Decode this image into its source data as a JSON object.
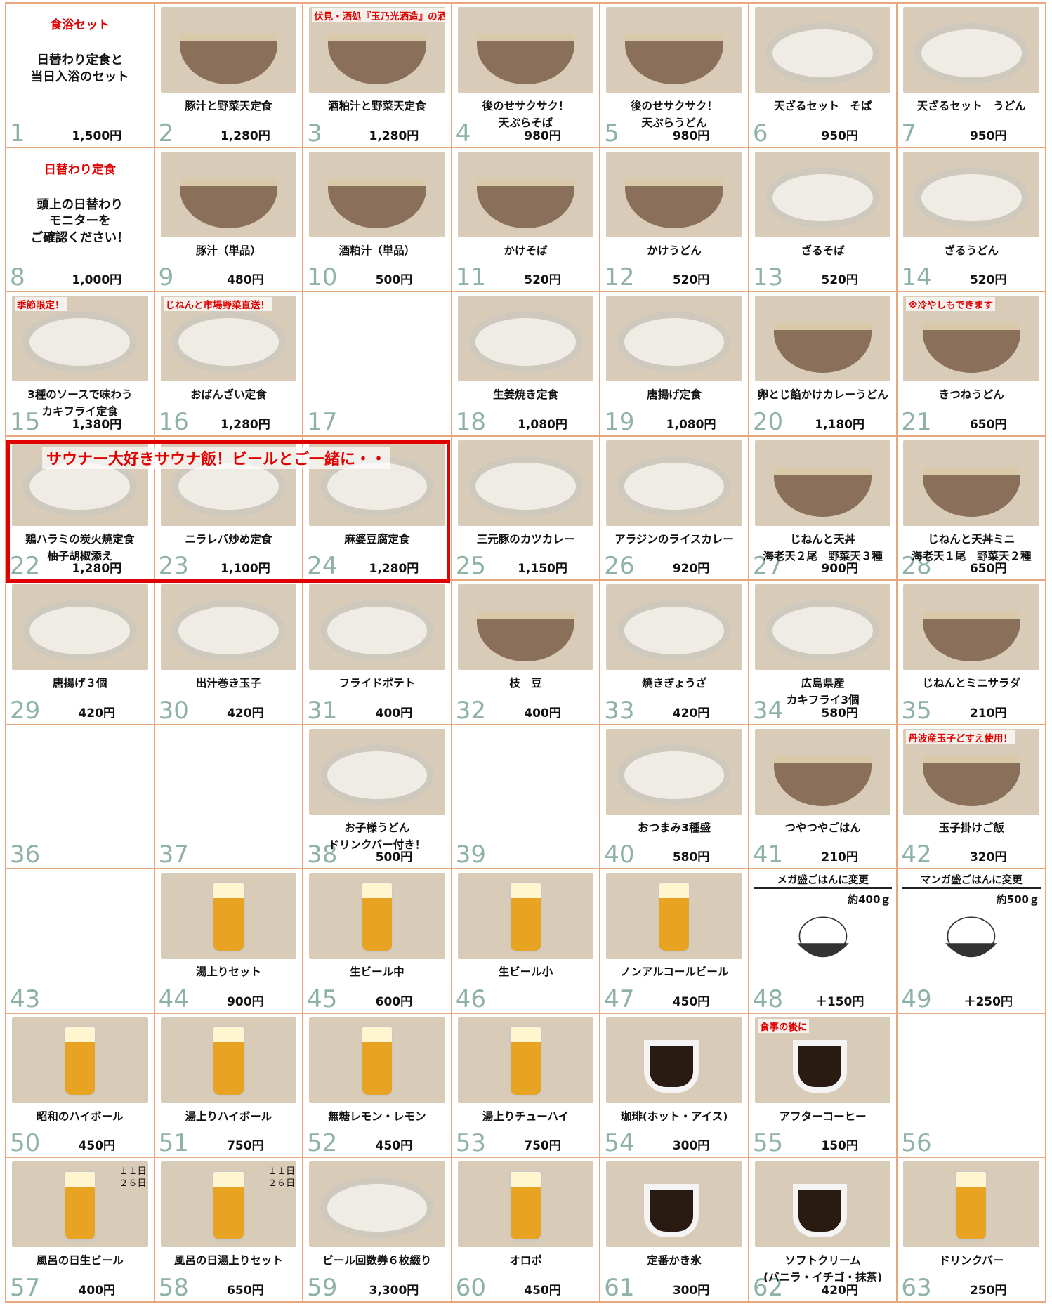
{
  "cells": [
    {
      "n": "1",
      "price": "1,500円",
      "kind": "text",
      "title": "食浴セット",
      "lines": [
        "日替わり定食と",
        "当日入浴のセット"
      ]
    },
    {
      "n": "2",
      "price": "1,280円",
      "name": "豚汁と野菜天定食",
      "kind": "photo",
      "ph": "bowl"
    },
    {
      "n": "3",
      "price": "1,280円",
      "name": "酒粕汁と野菜天定食",
      "kind": "photo",
      "ph": "bowl",
      "tag": "伏見・酒処『玉乃光酒造』の酒粕使用"
    },
    {
      "n": "4",
      "price": "980円",
      "name": "後のせサクサク！\n天ぷらそば",
      "kind": "photo",
      "ph": "bowl"
    },
    {
      "n": "5",
      "price": "980円",
      "name": "後のせサクサク！\n天ぷらうどん",
      "kind": "photo",
      "ph": "bowl"
    },
    {
      "n": "6",
      "price": "950円",
      "name": "天ざるセット　そば",
      "kind": "photo",
      "ph": "plate"
    },
    {
      "n": "7",
      "price": "950円",
      "name": "天ざるセット　うどん",
      "kind": "photo",
      "ph": "plate"
    },
    {
      "n": "8",
      "price": "1,000円",
      "kind": "text",
      "title": "日替わり定食",
      "lines": [
        "頭上の日替わり",
        "モニターを",
        "ご確認ください！"
      ]
    },
    {
      "n": "9",
      "price": "480円",
      "name": "豚汁（単品）",
      "kind": "photo",
      "ph": "bowl"
    },
    {
      "n": "10",
      "price": "500円",
      "name": "酒粕汁（単品）",
      "kind": "photo",
      "ph": "bowl"
    },
    {
      "n": "11",
      "price": "520円",
      "name": "かけそば",
      "kind": "photo",
      "ph": "bowl"
    },
    {
      "n": "12",
      "price": "520円",
      "name": "かけうどん",
      "kind": "photo",
      "ph": "bowl"
    },
    {
      "n": "13",
      "price": "520円",
      "name": "ざるそば",
      "kind": "photo",
      "ph": "plate"
    },
    {
      "n": "14",
      "price": "520円",
      "name": "ざるうどん",
      "kind": "photo",
      "ph": "plate"
    },
    {
      "n": "15",
      "price": "1,380円",
      "name": "3種のソースで味わう\nカキフライ定食",
      "kind": "photo",
      "ph": "plate",
      "tag": "季節限定！"
    },
    {
      "n": "16",
      "price": "1,280円",
      "name": "おばんざい定食",
      "kind": "photo",
      "ph": "plate",
      "tag": "じねんと市場野菜直送！"
    },
    {
      "n": "17",
      "kind": "empty"
    },
    {
      "n": "18",
      "price": "1,080円",
      "name": "生姜焼き定食",
      "kind": "photo",
      "ph": "plate"
    },
    {
      "n": "19",
      "price": "1,080円",
      "name": "唐揚げ定食",
      "kind": "photo",
      "ph": "plate"
    },
    {
      "n": "20",
      "price": "1,180円",
      "name": "卵とじ餡かけカレーうどん",
      "kind": "photo",
      "ph": "bowl"
    },
    {
      "n": "21",
      "price": "650円",
      "name": "きつねうどん",
      "kind": "photo",
      "ph": "bowl",
      "tag": "※冷やしもできます"
    },
    {
      "n": "22",
      "price": "1,280円",
      "name": "鶏ハラミの炭火焼定食\n柚子胡椒添え",
      "kind": "photo",
      "ph": "plate"
    },
    {
      "n": "23",
      "price": "1,100円",
      "name": "ニラレバ炒め定食",
      "kind": "photo",
      "ph": "plate"
    },
    {
      "n": "24",
      "price": "1,280円",
      "name": "麻婆豆腐定食",
      "kind": "photo",
      "ph": "plate"
    },
    {
      "n": "25",
      "price": "1,150円",
      "name": "三元豚のカツカレー",
      "kind": "photo",
      "ph": "plate"
    },
    {
      "n": "26",
      "price": "920円",
      "name": "アラジンのライスカレー",
      "kind": "photo",
      "ph": "plate"
    },
    {
      "n": "27",
      "price": "900円",
      "name": "じねんと天丼\n海老天２尾　野菜天３種",
      "kind": "photo",
      "ph": "bowl"
    },
    {
      "n": "28",
      "price": "650円",
      "name": "じねんと天丼ミニ\n海老天１尾　野菜天２種",
      "kind": "photo",
      "ph": "bowl"
    },
    {
      "n": "29",
      "price": "420円",
      "name": "唐揚げ３個",
      "kind": "photo",
      "ph": "plate"
    },
    {
      "n": "30",
      "price": "420円",
      "name": "出汁巻き玉子",
      "kind": "photo",
      "ph": "plate"
    },
    {
      "n": "31",
      "price": "400円",
      "name": "フライドポテト",
      "kind": "photo",
      "ph": "plate"
    },
    {
      "n": "32",
      "price": "400円",
      "name": "枝　豆",
      "kind": "photo",
      "ph": "bowl"
    },
    {
      "n": "33",
      "price": "420円",
      "name": "焼きぎょうざ",
      "kind": "photo",
      "ph": "plate"
    },
    {
      "n": "34",
      "price": "580円",
      "name": "広島県産\nカキフライ3個",
      "kind": "photo",
      "ph": "plate"
    },
    {
      "n": "35",
      "price": "210円",
      "name": "じねんとミニサラダ",
      "kind": "photo",
      "ph": "bowl"
    },
    {
      "n": "36",
      "kind": "empty"
    },
    {
      "n": "37",
      "kind": "empty"
    },
    {
      "n": "38",
      "price": "500円",
      "name": "お子様うどん\nドリンクバー付き！",
      "kind": "photo",
      "ph": "plate"
    },
    {
      "n": "39",
      "kind": "empty"
    },
    {
      "n": "40",
      "price": "580円",
      "name": "おつまみ3種盛",
      "kind": "photo",
      "ph": "plate"
    },
    {
      "n": "41",
      "price": "210円",
      "name": "つやつやごはん",
      "kind": "photo",
      "ph": "bowl"
    },
    {
      "n": "42",
      "price": "320円",
      "name": "玉子掛けご飯",
      "kind": "photo",
      "ph": "bowl",
      "tag": "丹波産玉子どすえ使用！"
    },
    {
      "n": "43",
      "kind": "empty"
    },
    {
      "n": "44",
      "price": "900円",
      "name": "湯上りセット",
      "kind": "photo",
      "ph": "glass"
    },
    {
      "n": "45",
      "price": "600円",
      "name": "生ビール中",
      "kind": "photo",
      "ph": "glass"
    },
    {
      "n": "46",
      "price": "",
      "name": "生ビール小",
      "kind": "photo",
      "ph": "glass"
    },
    {
      "n": "47",
      "price": "450円",
      "name": "ノンアルコールビール",
      "kind": "photo",
      "ph": "glass"
    },
    {
      "n": "48",
      "price": "＋150円",
      "kind": "rice",
      "header": "メガ盛ごはんに変更",
      "weight": "約400ｇ"
    },
    {
      "n": "49",
      "price": "＋250円",
      "kind": "rice",
      "header": "マンガ盛ごはんに変更",
      "weight": "約500ｇ"
    },
    {
      "n": "50",
      "price": "450円",
      "name": "昭和のハイボール",
      "kind": "photo",
      "ph": "glass"
    },
    {
      "n": "51",
      "price": "750円",
      "name": "湯上りハイボール",
      "kind": "photo",
      "ph": "glass"
    },
    {
      "n": "52",
      "price": "450円",
      "name": "無糖レモン・レモン",
      "kind": "photo",
      "ph": "glass"
    },
    {
      "n": "53",
      "price": "750円",
      "name": "湯上りチューハイ",
      "kind": "photo",
      "ph": "glass"
    },
    {
      "n": "54",
      "price": "300円",
      "name": "珈琲(ホット・アイス)",
      "kind": "photo",
      "ph": "cup"
    },
    {
      "n": "55",
      "price": "150円",
      "name": "アフターコーヒー",
      "kind": "photo",
      "ph": "cup",
      "tag": "食事の後に"
    },
    {
      "n": "56",
      "kind": "empty"
    },
    {
      "n": "57",
      "price": "400円",
      "name": "風呂の日生ビール",
      "kind": "photo",
      "ph": "glass",
      "days": "１１日\n２６日"
    },
    {
      "n": "58",
      "price": "650円",
      "name": "風呂の日湯上りセット",
      "kind": "photo",
      "ph": "glass",
      "days": "１１日\n２６日"
    },
    {
      "n": "59",
      "price": "3,300円",
      "name": "ビール回数券６枚綴り",
      "kind": "photo",
      "ph": "plate"
    },
    {
      "n": "60",
      "price": "450円",
      "name": "オロポ",
      "kind": "photo",
      "ph": "glass"
    },
    {
      "n": "61",
      "price": "300円",
      "name": "定番かき氷",
      "kind": "photo",
      "ph": "cup"
    },
    {
      "n": "62",
      "price": "420円",
      "name": "ソフトクリーム\n(バニラ・イチゴ・抹茶)",
      "kind": "photo",
      "ph": "cup"
    },
    {
      "n": "63",
      "price": "250円",
      "name": "ドリンクバー",
      "kind": "photo",
      "ph": "glass"
    }
  ],
  "sauna_banner": "サウナー大好きサウナ飯！ビールとご一緒に・・",
  "colors": {
    "border": "#e8a77c",
    "accent": "#e00000",
    "number": "#8fb3a3"
  }
}
